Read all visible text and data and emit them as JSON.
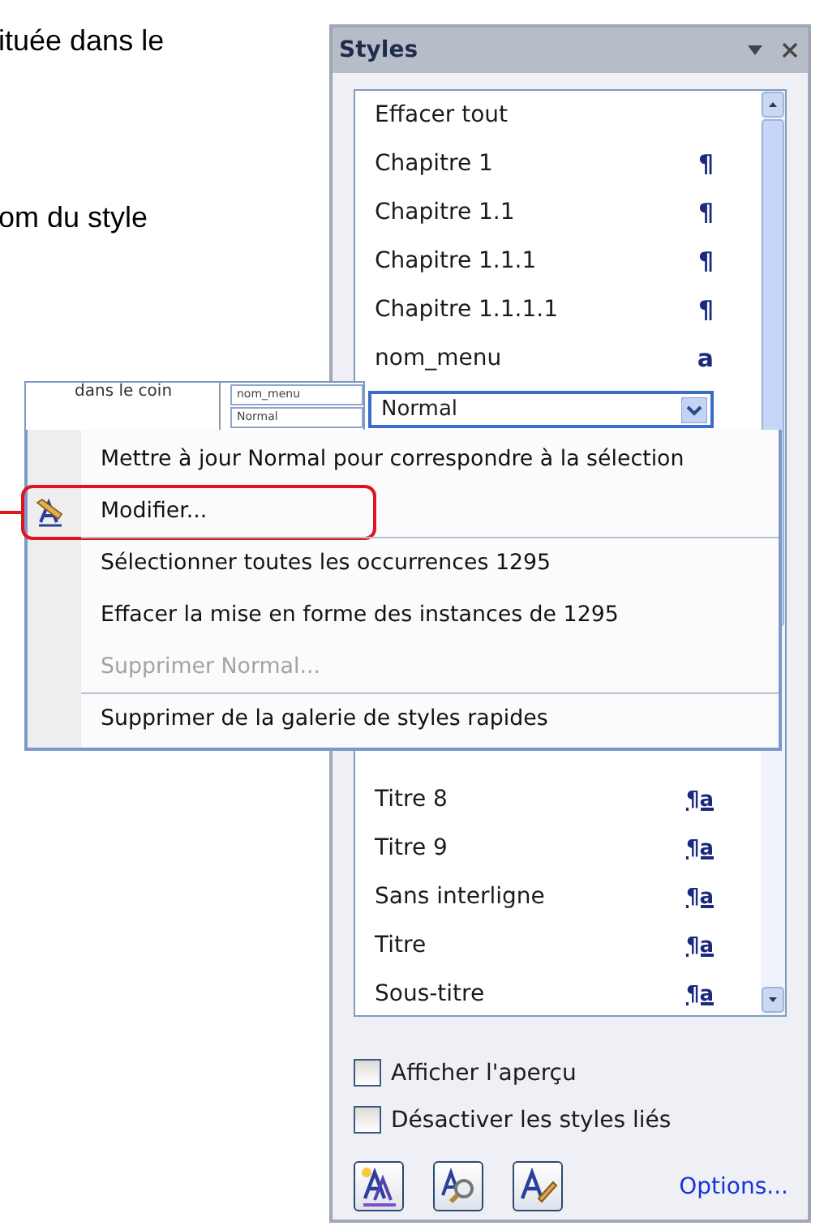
{
  "document_text": [
    "ituée dans le",
    "om du style"
  ],
  "document_fragment": {
    "text": "dans le coin",
    "style_labels": [
      "nom_menu",
      "Normal"
    ]
  },
  "styles_pane": {
    "title": "Styles",
    "styles": [
      {
        "name": "Effacer tout",
        "kind": "none",
        "selected": false
      },
      {
        "name": "Chapitre 1",
        "kind": "paragraph",
        "mark": "¶",
        "selected": false
      },
      {
        "name": "Chapitre 1.1",
        "kind": "paragraph",
        "mark": "¶",
        "selected": false
      },
      {
        "name": "Chapitre 1.1.1",
        "kind": "paragraph",
        "mark": "¶",
        "selected": false
      },
      {
        "name": "Chapitre 1.1.1.1",
        "kind": "paragraph",
        "mark": "¶",
        "selected": false
      },
      {
        "name": "nom_menu",
        "kind": "character",
        "mark": "a",
        "selected": false
      },
      {
        "name": "Normal",
        "selected": true
      },
      {
        "name": "Titre 8",
        "kind": "linked",
        "mark": "¶a",
        "selected": false
      },
      {
        "name": "Titre 9",
        "kind": "linked",
        "mark": "¶a",
        "selected": false
      },
      {
        "name": "Sans interligne",
        "kind": "linked",
        "mark": "¶a",
        "selected": false
      },
      {
        "name": "Titre",
        "kind": "linked",
        "mark": "¶a",
        "selected": false
      },
      {
        "name": "Sous-titre",
        "kind": "linked",
        "mark": "¶a",
        "selected": false
      }
    ],
    "checkboxes": [
      {
        "label": "Afficher l'aperçu",
        "checked": false
      },
      {
        "label": "Désactiver les styles liés",
        "checked": false
      }
    ],
    "options_link": "Options..."
  },
  "context_menu": [
    {
      "label": "Mettre à jour Normal pour correspondre à la sélection",
      "kind": "plain",
      "disabled": false,
      "separator_before": false,
      "highlighted": false
    },
    {
      "label": "Modifier...",
      "kind": "modify",
      "disabled": false,
      "separator_before": false,
      "highlighted": true
    },
    {
      "label": "Sélectionner toutes les occurrences 1295",
      "kind": "plain",
      "disabled": false,
      "separator_before": true,
      "highlighted": false
    },
    {
      "label": "Effacer la mise en forme des instances de 1295",
      "kind": "plain",
      "disabled": false,
      "separator_before": false,
      "highlighted": false
    },
    {
      "label": "Supprimer Normal...",
      "kind": "plain",
      "disabled": true,
      "separator_before": false,
      "highlighted": false
    },
    {
      "label": "Supprimer de la galerie de styles rapides",
      "kind": "plain",
      "disabled": false,
      "separator_before": true,
      "highlighted": false
    }
  ]
}
